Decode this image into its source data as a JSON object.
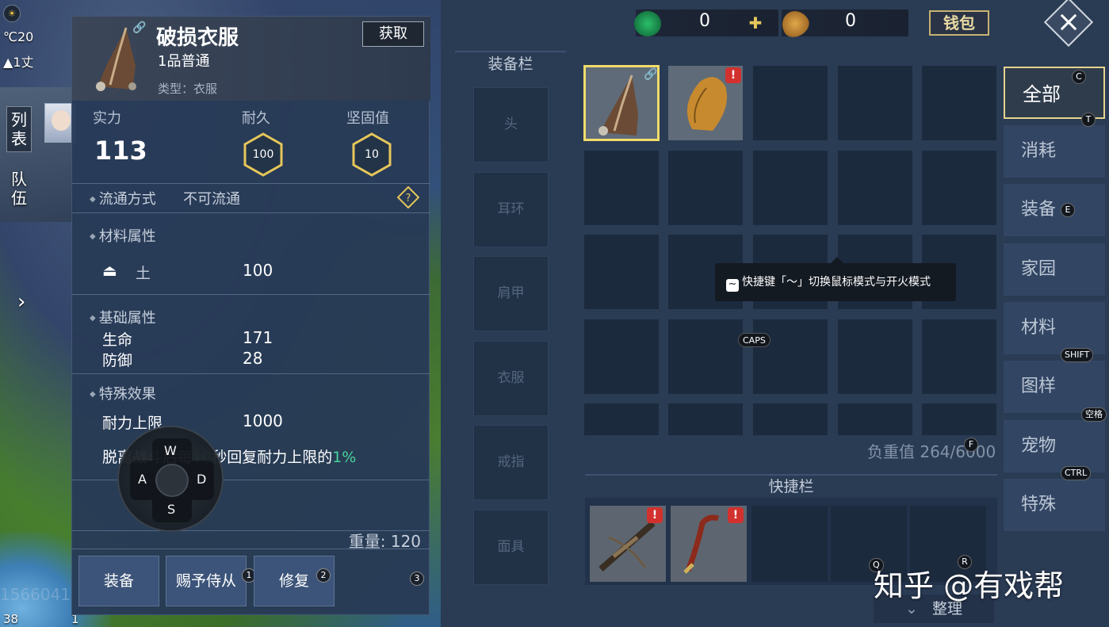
{
  "hud": {
    "temperature": "℃20",
    "height": "1丈",
    "list_tab": "列表",
    "team_tab": "队伍",
    "bottom_left_num": "38",
    "bottom_small_num": "1",
    "faint_id": "15660412587486"
  },
  "item": {
    "name": "破损衣服",
    "grade": "1品普通",
    "type": "类型：衣服",
    "obtain_label": "获取",
    "power_label": "实力",
    "power_value": "113",
    "durability_label": "耐久",
    "durability_value": "100",
    "firmness_label": "坚固值",
    "firmness_value": "10",
    "flow_label": "流通方式",
    "flow_value": "不可流通",
    "material_title": "材料属性",
    "material_name": "土",
    "material_value": "100",
    "base_title": "基础属性",
    "hp_label": "生命",
    "hp_value": "171",
    "def_label": "防御",
    "def_value": "28",
    "special_title": "特殊效果",
    "stamina_label": "耐力上限",
    "stamina_value": "1000",
    "effect_pre": "脱离战斗后每",
    "effect_num1": "10",
    "effect_mid": "秒回复耐力上限的",
    "effect_num2": "1%",
    "weight": "重量: 120"
  },
  "actions": [
    {
      "label": "装备",
      "key": ""
    },
    {
      "label": "赐予侍从",
      "key": "1"
    },
    {
      "label": "修复",
      "key": "2"
    },
    {
      "label": "",
      "key": "3"
    }
  ],
  "joystick": {
    "up": "W",
    "left": "A",
    "right": "D",
    "down": "S"
  },
  "inventory": {
    "currency1": "0",
    "currency2": "0",
    "wallet_label": "钱包",
    "equip_title": "装备栏",
    "equip_slots": [
      "头",
      "耳环",
      "肩甲",
      "衣服",
      "戒指",
      "面具"
    ],
    "load_text": "负重值 264/6000",
    "quick_title": "快捷栏",
    "sort_label": "整理",
    "tooltip": "快捷键「～」切换鼠标模式与开火模式",
    "tooltip_key": "~",
    "caps_key": "CAPS",
    "quick_keys": [
      "Q",
      "R"
    ],
    "categories": [
      {
        "label": "全部",
        "key": "C"
      },
      {
        "label": "消耗",
        "key": "T"
      },
      {
        "label": "装备",
        "key": "E"
      },
      {
        "label": "家园",
        "key": ""
      },
      {
        "label": "材料",
        "key": ""
      },
      {
        "label": "图样",
        "key": "SHIFT"
      },
      {
        "label": "宠物",
        "key": "空格"
      },
      {
        "label": "特殊",
        "key": "CTRL"
      }
    ],
    "load_key": "F"
  },
  "watermark": "知乎 @有戏帮",
  "colors": {
    "accent_gold": "#f2dc6b",
    "highlight_green": "#49d29b",
    "warning_red": "#d2312e"
  }
}
